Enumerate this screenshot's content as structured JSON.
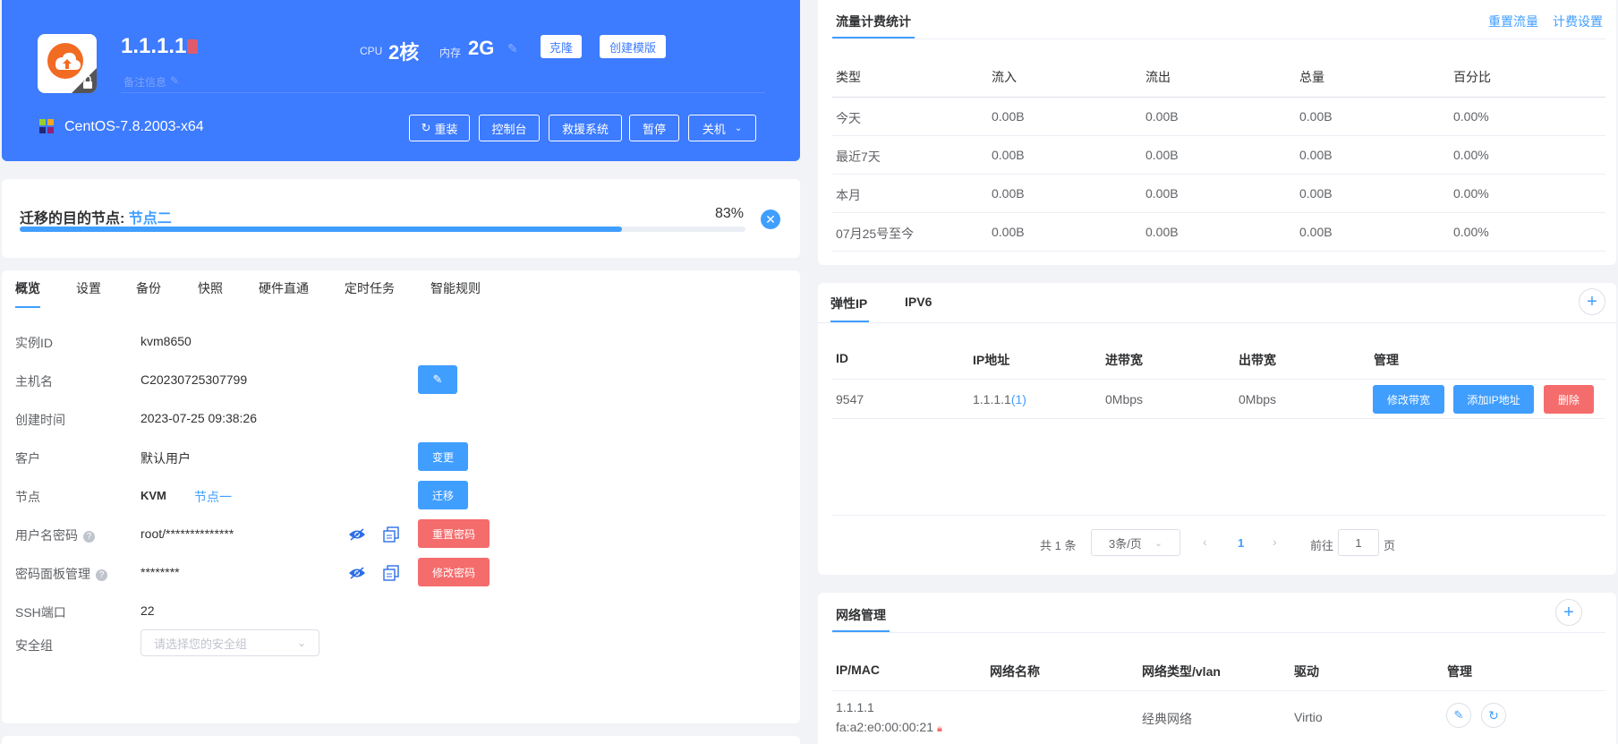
{
  "colors": {
    "primary": "#3d7bff",
    "accent": "#409eff",
    "danger": "#f56c6c"
  },
  "instance": {
    "ip": "1.1.1.1",
    "remark_placeholder": "备注信息",
    "cpu_label": "CPU",
    "cpu_value": "2核",
    "mem_label": "内存",
    "mem_value": "2G",
    "clone_btn": "克隆",
    "template_btn": "创建模版",
    "os": "CentOS-7.8.2003-x64",
    "actions": {
      "reinstall": "重装",
      "console": "控制台",
      "rescue": "救援系统",
      "pause": "暂停",
      "power": "关机"
    }
  },
  "migration": {
    "label": "迁移的目的节点:",
    "node": "节点二",
    "percent_text": "83%",
    "progress": 0.83
  },
  "tabs": [
    "概览",
    "设置",
    "备份",
    "快照",
    "硬件直通",
    "定时任务",
    "智能规则"
  ],
  "overview": {
    "instance_id_label": "实例ID",
    "instance_id": "kvm8650",
    "hostname_label": "主机名",
    "hostname": "C20230725307799",
    "created_label": "创建时间",
    "created": "2023-07-25 09:38:26",
    "customer_label": "客户",
    "customer": "默认用户",
    "change_btn": "变更",
    "node_label": "节点",
    "node_type": "KVM",
    "node_name": "节点一",
    "migrate_btn": "迁移",
    "userpass_label": "用户名密码",
    "userpass": "root/**************",
    "reset_pwd_btn": "重置密码",
    "panelpass_label": "密码面板管理",
    "panelpass": "********",
    "modify_pwd_btn": "修改密码",
    "ssh_label": "SSH端口",
    "ssh": "22",
    "secgroup_label": "安全组",
    "secgroup_placeholder": "请选择您的安全组"
  },
  "traffic": {
    "title": "流量计费统计",
    "reset_link": "重置流量",
    "billing_link": "计费设置",
    "headers": [
      "类型",
      "流入",
      "流出",
      "总量",
      "百分比"
    ],
    "rows": [
      [
        "今天",
        "0.00B",
        "0.00B",
        "0.00B",
        "0.00%"
      ],
      [
        "最近7天",
        "0.00B",
        "0.00B",
        "0.00B",
        "0.00%"
      ],
      [
        "本月",
        "0.00B",
        "0.00B",
        "0.00B",
        "0.00%"
      ],
      [
        "07月25号至今",
        "0.00B",
        "0.00B",
        "0.00B",
        "0.00%"
      ]
    ]
  },
  "eip": {
    "tabs": [
      "弹性IP",
      "IPV6"
    ],
    "headers": [
      "ID",
      "IP地址",
      "进带宽",
      "出带宽",
      "管理"
    ],
    "row": {
      "id": "9547",
      "ip": "1.1.1.1",
      "ip_count": "(1)",
      "in_bw": "0Mbps",
      "out_bw": "0Mbps"
    },
    "actions": {
      "modify_bw": "修改带宽",
      "add_ip": "添加IP地址",
      "delete": "删除"
    },
    "pagination": {
      "total": "共 1 条",
      "page_size": "3条/页",
      "current": "1",
      "goto_label": "前往",
      "goto_value": "1",
      "page_suffix": "页"
    }
  },
  "network": {
    "title": "网络管理",
    "headers": [
      "IP/MAC",
      "网络名称",
      "网络类型/vlan",
      "驱动",
      "管理"
    ],
    "row": {
      "ip": "1.1.1.1",
      "mac": "fa:a2:e0:00:00:21",
      "name": "",
      "type": "经典网络",
      "driver": "Virtio"
    }
  }
}
